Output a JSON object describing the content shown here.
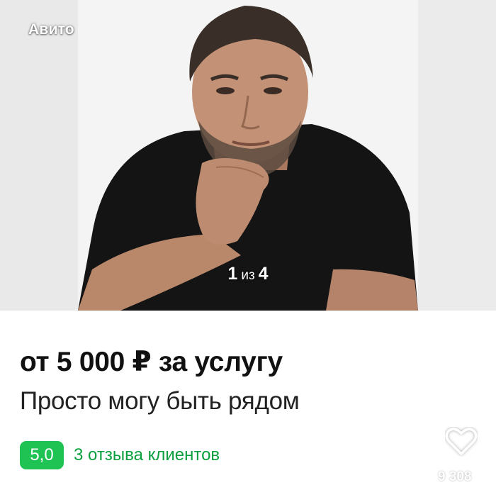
{
  "gallery": {
    "watermark": "Авито",
    "counter_current": "1",
    "counter_separator": "из",
    "counter_total": "4",
    "photo_icon": "person-photo"
  },
  "listing": {
    "price": "от 5 000 ₽ за услугу",
    "title": "Просто могу быть рядом",
    "rating": "5,0",
    "reviews": "3 отзыва клиентов",
    "favorite_icon": "heart-icon",
    "views": "9 308"
  },
  "colors": {
    "rating_badge": "#1fc353",
    "reviews_text": "#0a9f3d",
    "price_text": "#111111"
  }
}
